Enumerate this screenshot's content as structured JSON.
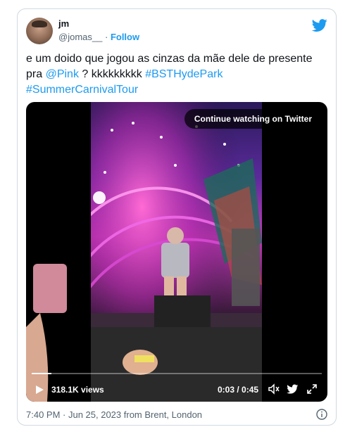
{
  "author": {
    "name": "jm",
    "handle": "@jomas__",
    "separator": "·",
    "follow_label": "Follow"
  },
  "tweet": {
    "text_plain_1": "e um doido que jogou as cinzas da mãe dele de presente pra ",
    "mention": "@Pink",
    "text_plain_2": " ? kkkkkkkkk ",
    "hashtag_1": "#BSTHydePark",
    "hashtag_2": "#SummerCarnivalTour"
  },
  "video": {
    "overlay_label": "Continue watching on Twitter",
    "views": "318.1K views",
    "time": "0:03 / 0:45",
    "progress": 0.067
  },
  "footer": {
    "timestamp": "7:40 PM · Jun 25, 2023 from Brent, London"
  },
  "colors": {
    "accent": "#1d9bf0",
    "secondary_text": "#536471",
    "border": "#cfd9de"
  },
  "icons": [
    "twitter-bird-icon",
    "play-icon",
    "volume-icon",
    "twitter-bird-icon",
    "fullscreen-icon",
    "info-icon"
  ]
}
